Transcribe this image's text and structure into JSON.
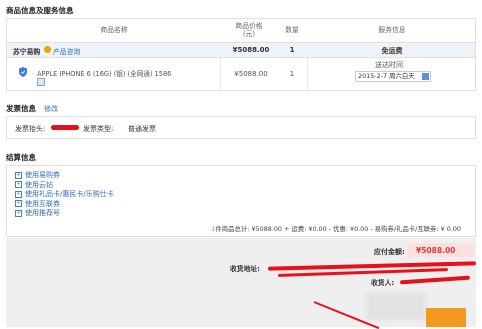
{
  "goods_section": {
    "title": "商品信息及服务信息",
    "headers": {
      "name": "商品名称",
      "price_line1": "商品价格",
      "price_line2": "(元)",
      "qty": "数量",
      "service": "服务信息"
    },
    "store": {
      "name": "苏宁易购",
      "consult": "产品咨询",
      "price": "¥5088.00",
      "qty": "1",
      "service": "免运费"
    },
    "product": {
      "name": "APPLE IPHONE 6 (16G) (银) (全网通) 1586",
      "price": "¥5088.00",
      "qty": "1",
      "delivery_label": "送达时间",
      "delivery_value": "2015-2-7 周六白天"
    }
  },
  "invoice_section": {
    "title": "发票信息",
    "edit": "修改",
    "title_label": "发票抬头:",
    "type_label": "发票类型:",
    "type_value": "普通发票"
  },
  "settle_section": {
    "title": "结算信息",
    "options": [
      "使用易购券",
      "使用云钻",
      "使用礼品卡/惠民卡/乐购仕卡",
      "使用互联券",
      "使用推荐号"
    ],
    "summary": {
      "count": "1",
      "text": "件商品总计: ¥5088.00 + 运费: ¥0.00 - 优惠: ¥0.00 - 易购券/礼品卡/互联券: ¥ 0.00"
    }
  },
  "payment": {
    "due_label": "应付金额:",
    "due_value": "¥5088.00",
    "address_label": "收货地址:",
    "receiver_label": "收货人:"
  },
  "colors": {
    "accent_red": "#e4393c",
    "price_orange": "#f08300",
    "link_blue": "#2b6dbb"
  }
}
